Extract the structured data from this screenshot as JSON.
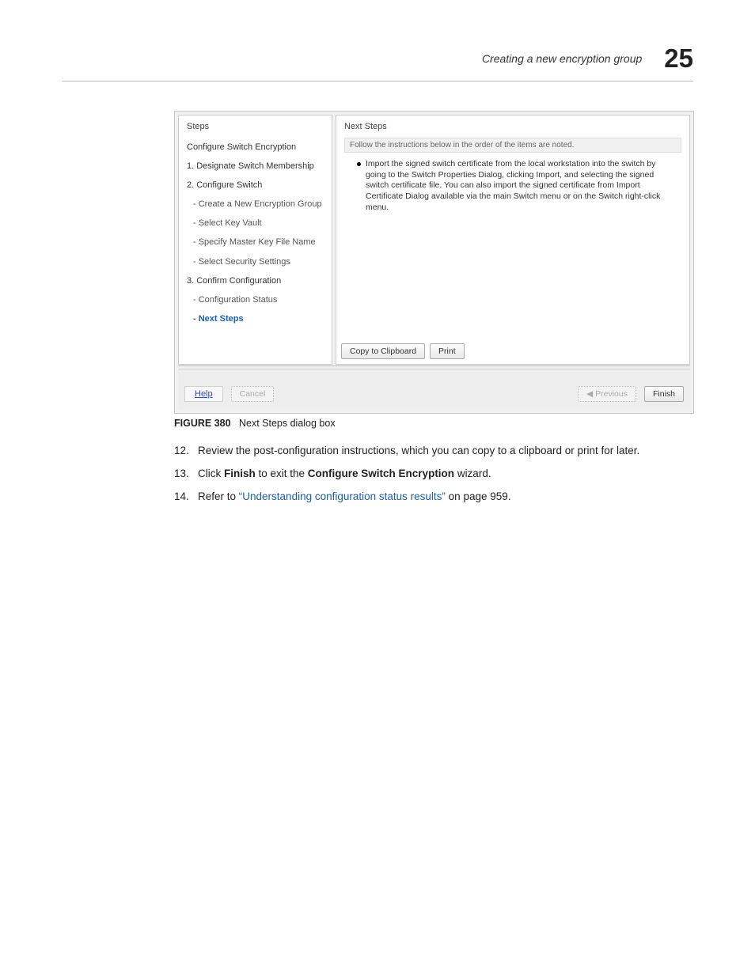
{
  "header": {
    "section_title": "Creating a new encryption group",
    "chapter_number": "25"
  },
  "dialog": {
    "steps_title": "Steps",
    "steps": [
      {
        "label": "Configure Switch Encryption",
        "kind": "plain"
      },
      {
        "label": "1. Designate Switch Membership",
        "kind": "plain"
      },
      {
        "label": "2. Configure Switch",
        "kind": "plain"
      },
      {
        "label": "- Create a New Encryption Group",
        "kind": "sub"
      },
      {
        "label": "- Select Key Vault",
        "kind": "sub"
      },
      {
        "label": "- Specify Master Key File Name",
        "kind": "sub"
      },
      {
        "label": "- Select Security Settings",
        "kind": "sub"
      },
      {
        "label": "3. Confirm Configuration",
        "kind": "plain"
      },
      {
        "label": "- Configuration Status",
        "kind": "sub"
      },
      {
        "label": "- Next Steps",
        "kind": "active"
      }
    ],
    "main_title": "Next Steps",
    "instruction_bar": "Follow the instructions below in the order of the items are noted.",
    "bullet_1": "Import the signed switch certificate from the local workstation into the switch by going to the Switch Properties Dialog, clicking Import, and selecting the signed switch certificate file. You can also import the signed certificate from Import Certificate Dialog available via the main Switch menu or on the Switch right-click menu.",
    "btn_copy": "Copy to Clipboard",
    "btn_print": "Print",
    "btn_help": "Help",
    "btn_cancel": "Cancel",
    "btn_previous": "Previous",
    "btn_finish": "Finish"
  },
  "caption": {
    "label": "FIGURE 380",
    "text": "Next Steps dialog box"
  },
  "body": {
    "item12_num": "12.",
    "item12_text": "Review the post-configuration instructions, which you can copy to a clipboard or print for later.",
    "item13_num": "13.",
    "item13_prefix": "Click ",
    "item13_bold1": "Finish",
    "item13_mid": " to exit the ",
    "item13_bold2": "Configure Switch Encryption",
    "item13_suffix": " wizard.",
    "item14_num": "14.",
    "item14_prefix": "Refer to ",
    "item14_link": "“Understanding configuration status results”",
    "item14_suffix": " on page 959."
  }
}
